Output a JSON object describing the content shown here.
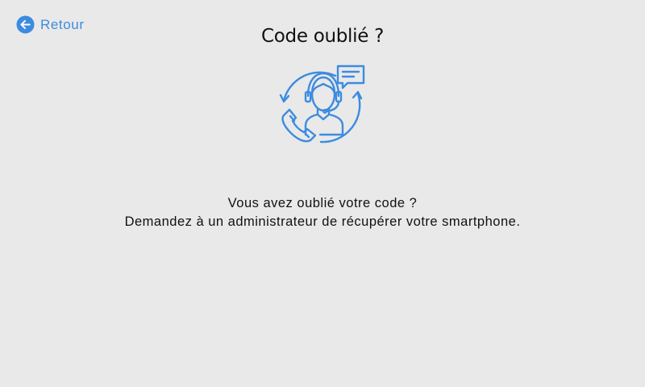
{
  "header": {
    "back_label": "Retour",
    "title": "Code oublié ?"
  },
  "icons": {
    "back": "arrow-left-circle-icon",
    "illustration": "support-agent-icon"
  },
  "message": {
    "line1": "Vous avez oublié votre code ?",
    "line2": "Demandez à un administrateur de récupérer votre smartphone."
  },
  "colors": {
    "background": "#e9e9e9",
    "accent": "#3d8be0",
    "text": "#111111"
  }
}
